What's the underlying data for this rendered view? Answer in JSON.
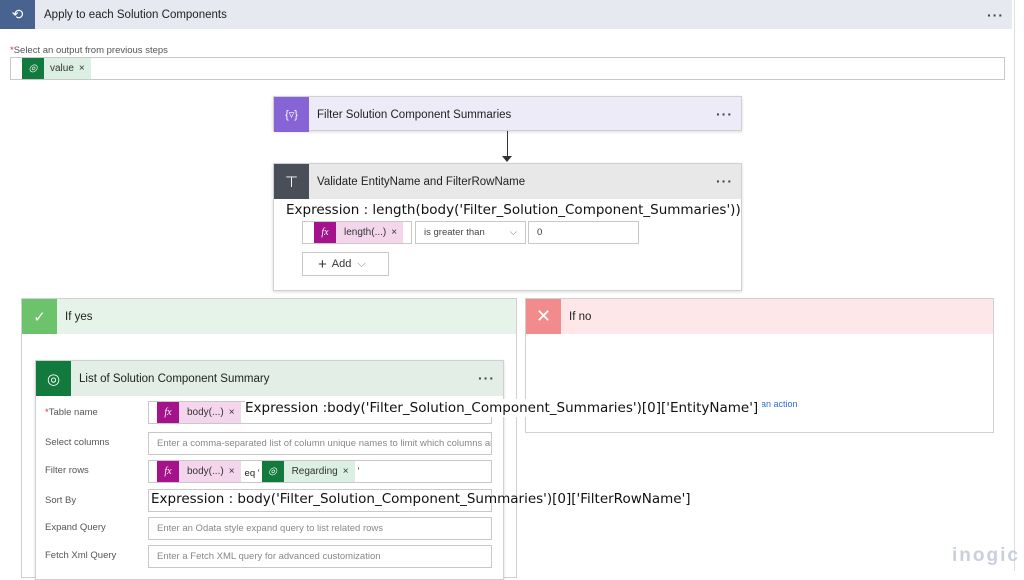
{
  "loop": {
    "title": "Apply to each Solution Components",
    "required_mark": "*",
    "field_label": "Select an output from previous steps",
    "chip": "value",
    "chip_close": "×",
    "more": "···"
  },
  "filter_card": {
    "title": "Filter Solution Component Summaries",
    "icon": "{▿}",
    "more": "···"
  },
  "condition": {
    "title": "Validate EntityName and FilterRowName",
    "more": "···",
    "expression_note": "Expression : length(body('Filter_Solution_Component_Summaries'))",
    "left_chip": "length(...)",
    "chip_close": "×",
    "operator": "is greater than",
    "value": "0",
    "add_label": "Add"
  },
  "if_yes": {
    "title": "If yes"
  },
  "if_no": {
    "title": "If no",
    "add_action": "an action"
  },
  "list_action": {
    "title": "List of Solution Component Summary",
    "more": "···",
    "rows": [
      {
        "label": "Table name",
        "required": "*",
        "chip": "body(...)"
      },
      {
        "label": "Select columns",
        "placeholder": "Enter a comma-separated list of column unique names to limit which columns are listed"
      },
      {
        "label": "Filter rows",
        "chip": "body(...)",
        "op": "eq '",
        "chip2": "Regarding",
        "tail": "'"
      },
      {
        "label": "Sort By"
      },
      {
        "label": "Expand Query",
        "placeholder": "Enter an Odata style expand query to list related rows"
      },
      {
        "label": "Fetch Xml Query",
        "placeholder": "Enter a Fetch XML query for advanced customization"
      }
    ],
    "chip_close": "×",
    "expr_table": "Expression :body('Filter_Solution_Component_Summaries')[0]['EntityName']",
    "expr_sort": "Expression : body('Filter_Solution_Component_Summaries')[0]['FilterRowName']"
  },
  "watermark": "inogic",
  "colors": {
    "loop_icon": "#48638f",
    "filter_icon": "#8764d6",
    "condition_icon": "#484f58",
    "yes": "#5cb85c",
    "no": "#f28b8b",
    "dataverse": "#117a3c",
    "expression": "#a4128c"
  }
}
